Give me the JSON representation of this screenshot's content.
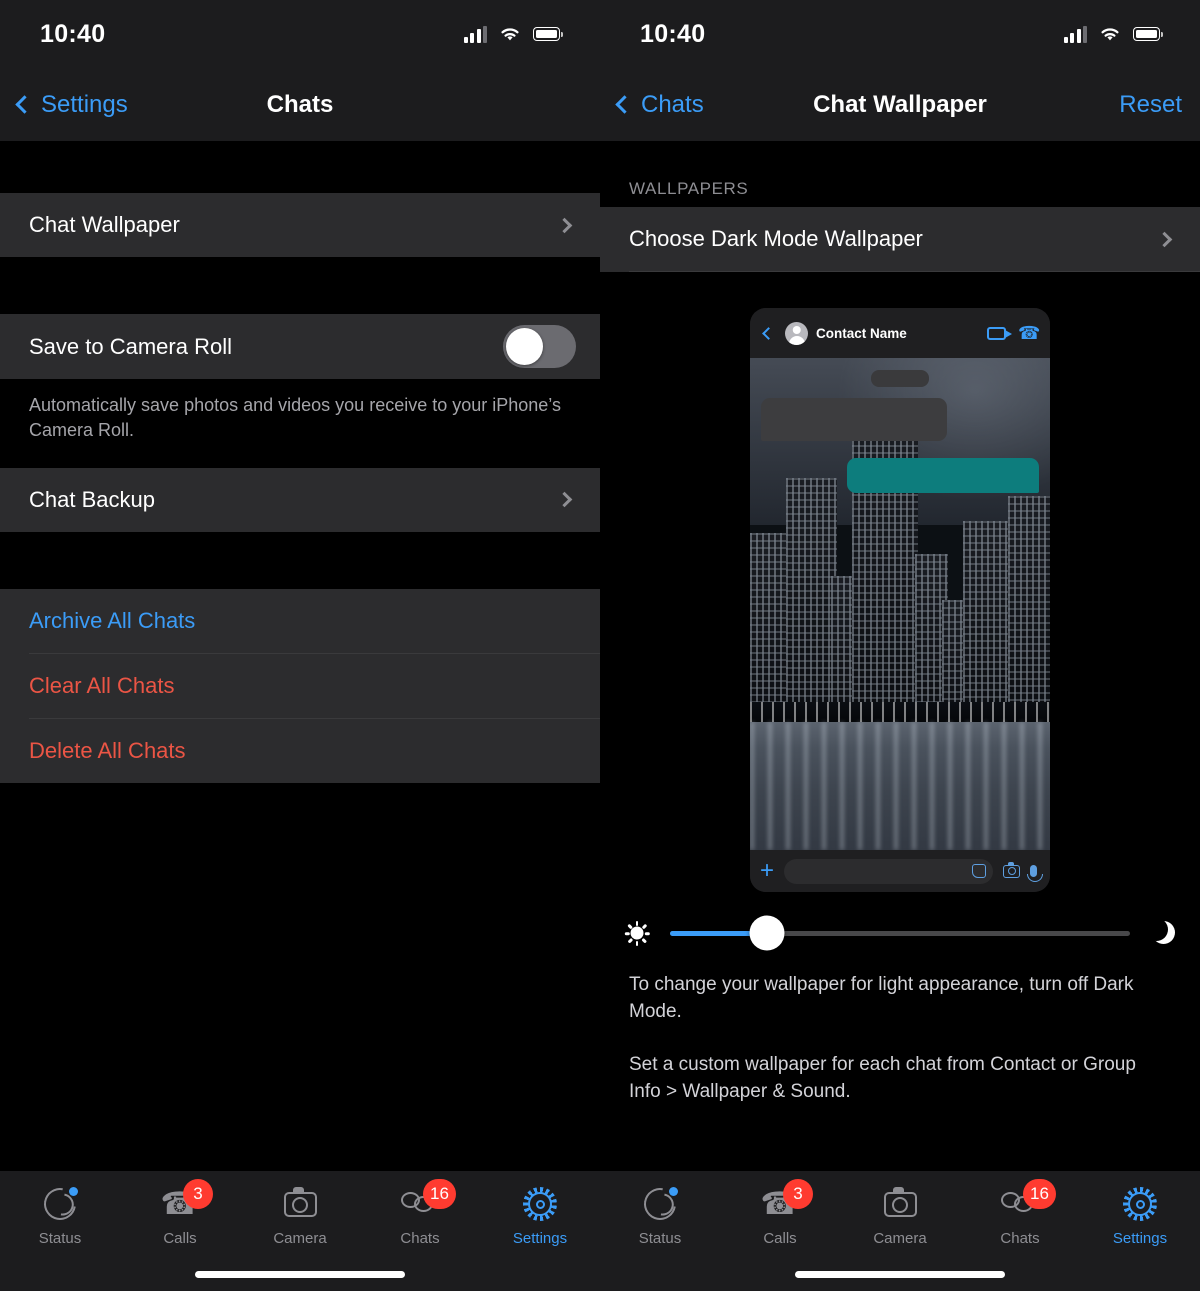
{
  "status_bar": {
    "time": "10:40",
    "signal_icon": "cellular-bars-icon",
    "wifi_icon": "wifi-icon",
    "battery_icon": "battery-full-icon"
  },
  "left_screen": {
    "nav": {
      "back_label": "Settings",
      "title": "Chats"
    },
    "rows": {
      "chat_wallpaper": "Chat Wallpaper",
      "save_to_camera_roll": "Save to Camera Roll",
      "save_footnote": "Automatically save photos and videos you receive to your iPhone’s Camera Roll.",
      "chat_backup": "Chat Backup",
      "archive_all": "Archive All Chats",
      "clear_all": "Clear All Chats",
      "delete_all": "Delete All Chats"
    },
    "toggle_state": "off"
  },
  "right_screen": {
    "nav": {
      "back_label": "Chats",
      "title": "Chat Wallpaper",
      "reset_label": "Reset"
    },
    "section_header": "WALLPAPERS",
    "choose_wallpaper": "Choose Dark Mode Wallpaper",
    "preview": {
      "contact_name": "Contact Name",
      "back_icon": "chevron-left-icon",
      "avatar_icon": "avatar-icon",
      "video_icon": "video-call-icon",
      "phone_icon": "voice-call-icon",
      "plus_icon": "plus-icon",
      "sticker_icon": "sticker-icon",
      "camera_icon": "camera-icon",
      "mic_icon": "microphone-icon",
      "wallpaper_description": "night city skyline with water reflection"
    },
    "slider": {
      "left_icon": "sun-icon",
      "right_icon": "moon-icon",
      "value_percent": 21
    },
    "info_1": "To change your wallpaper for light appearance, turn off Dark Mode.",
    "info_2": "Set a custom wallpaper for each chat from Contact or Group Info > Wallpaper & Sound."
  },
  "tabbar": {
    "items": [
      {
        "label": "Status",
        "icon": "status-icon",
        "badge": "",
        "dot": true,
        "active": false
      },
      {
        "label": "Calls",
        "icon": "phone-icon",
        "badge": "3",
        "dot": false,
        "active": false
      },
      {
        "label": "Camera",
        "icon": "camera-icon",
        "badge": "",
        "dot": false,
        "active": false
      },
      {
        "label": "Chats",
        "icon": "chats-icon",
        "badge": "16",
        "dot": false,
        "active": false
      },
      {
        "label": "Settings",
        "icon": "gear-icon",
        "badge": "",
        "dot": false,
        "active": true
      }
    ]
  },
  "colors": {
    "accent_blue": "#3b9cf7",
    "destructive_red": "#eb5545",
    "badge_red": "#ff3b30",
    "group_bg": "#2c2c2e",
    "bubble_out": "#0d7d7d"
  }
}
